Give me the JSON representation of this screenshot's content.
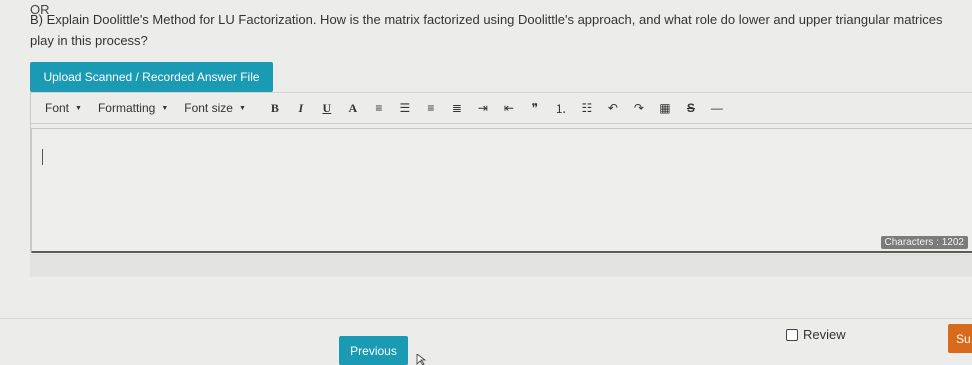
{
  "or_label": "OR",
  "question": {
    "text": "B) Explain Doolittle's Method for LU Factorization. How is the matrix factorized using Doolittle's approach, and what role do lower and upper triangular matrices play in this process?"
  },
  "upload_button": "Upload Scanned / Recorded Answer File",
  "toolbar": {
    "font_label": "Font",
    "formatting_label": "Formatting",
    "font_size_label": "Font size",
    "bold": "B",
    "italic": "I",
    "underline": "U",
    "font_color": "A",
    "align_left": "≡",
    "align_center": "☰",
    "align_right": "≡",
    "justify": "≣",
    "indent": "⇥",
    "outdent": "⇤",
    "blockquote": "❞",
    "ordered_list": "⒈",
    "unordered_list": "☷",
    "undo": "↶",
    "redo": "↷",
    "table": "▦",
    "strikethrough": "S",
    "horizontal_rule": "—"
  },
  "editor": {
    "value": ""
  },
  "characters": "Characters : 1202",
  "review_label": "Review",
  "previous_button": "Previous",
  "submit_button": "Su",
  "colors": {
    "accent": "#1b9ab4",
    "submit": "#d86a1c",
    "background": "#ececea"
  }
}
